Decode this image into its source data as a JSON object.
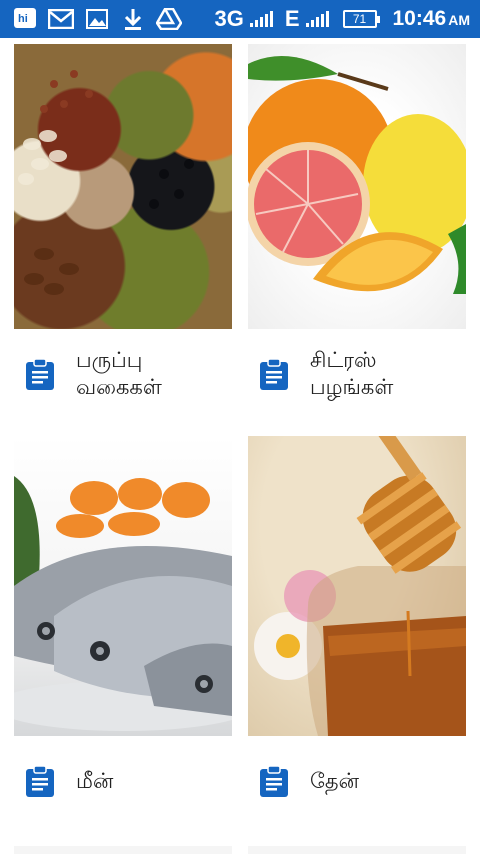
{
  "status_bar": {
    "left_icons": [
      "hike-app-icon",
      "gmail-icon",
      "gallery-icon",
      "download-icon",
      "drive-icon"
    ],
    "network_3g": "3G",
    "network_e": "E",
    "battery_level": "71",
    "time": "10:46",
    "ampm": "AM"
  },
  "theme": {
    "status_bar_color": "#1565c0",
    "accent_icon_color": "#1565c0"
  },
  "categories": [
    {
      "label": "பருப்பு வகைகள்",
      "image": "legumes-photo",
      "icon": "clipboard-icon"
    },
    {
      "label": "சிட்ரஸ் பழங்கள்",
      "image": "citrus-fruits-photo",
      "icon": "clipboard-icon"
    },
    {
      "label": "மீன்",
      "image": "fish-photo",
      "icon": "clipboard-icon"
    },
    {
      "label": "தேன்",
      "image": "honey-photo",
      "icon": "clipboard-icon"
    }
  ]
}
